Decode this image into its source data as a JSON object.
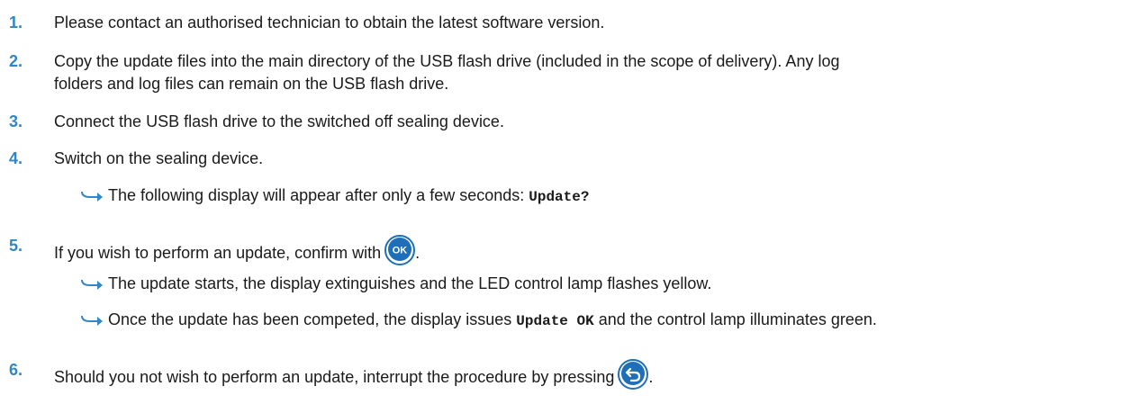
{
  "steps": [
    {
      "num": "1.",
      "text": "Please contact an authorised technician to obtain the latest software version."
    },
    {
      "num": "2.",
      "line1": "Copy the update files into the main directory of the USB flash drive (included in the scope of delivery). Any log",
      "line2": "folders and log files can remain on the USB flash drive."
    },
    {
      "num": "3.",
      "text": "Connect the USB flash drive to the switched off sealing device."
    },
    {
      "num": "4.",
      "text": "Switch on the sealing device.",
      "result": {
        "text": "The following display will appear after only a few seconds: ",
        "code": "Update?"
      }
    },
    {
      "num": "5.",
      "text": "If you wish to perform an update, confirm with",
      "key_label": "OK",
      "after": ".",
      "results": [
        {
          "text": "The update starts, the display extinguishes and the LED control lamp flashes yellow."
        },
        {
          "pre": "Once the update has been competed, the display issues ",
          "code": "Update OK",
          "post": " and the control lamp illuminates green."
        }
      ]
    },
    {
      "num": "6.",
      "text": "Should you not wish to perform an update, interrupt the procedure by pressing",
      "key_icon": "back-arrow-icon",
      "after": "."
    }
  ],
  "colors": {
    "accent": "#2f86c8",
    "button_fill": "#1e6fb8",
    "text": "#1a1a1a"
  }
}
